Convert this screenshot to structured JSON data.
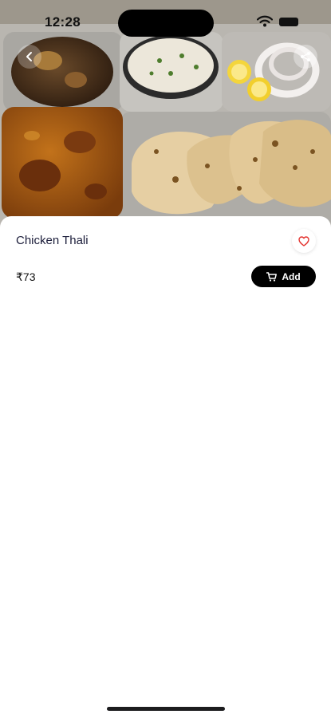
{
  "status_bar": {
    "time": "12:28"
  },
  "product": {
    "name": "Chicken Thali",
    "price": "₹73",
    "add_label": "Add"
  },
  "icons": {
    "back": "chevron-left-icon",
    "share": "share-icon",
    "favorite": "heart-icon",
    "cart": "cart-icon"
  },
  "colors": {
    "button_bg": "#000000",
    "heart": "#e53935",
    "title": "#1b1d3a"
  }
}
